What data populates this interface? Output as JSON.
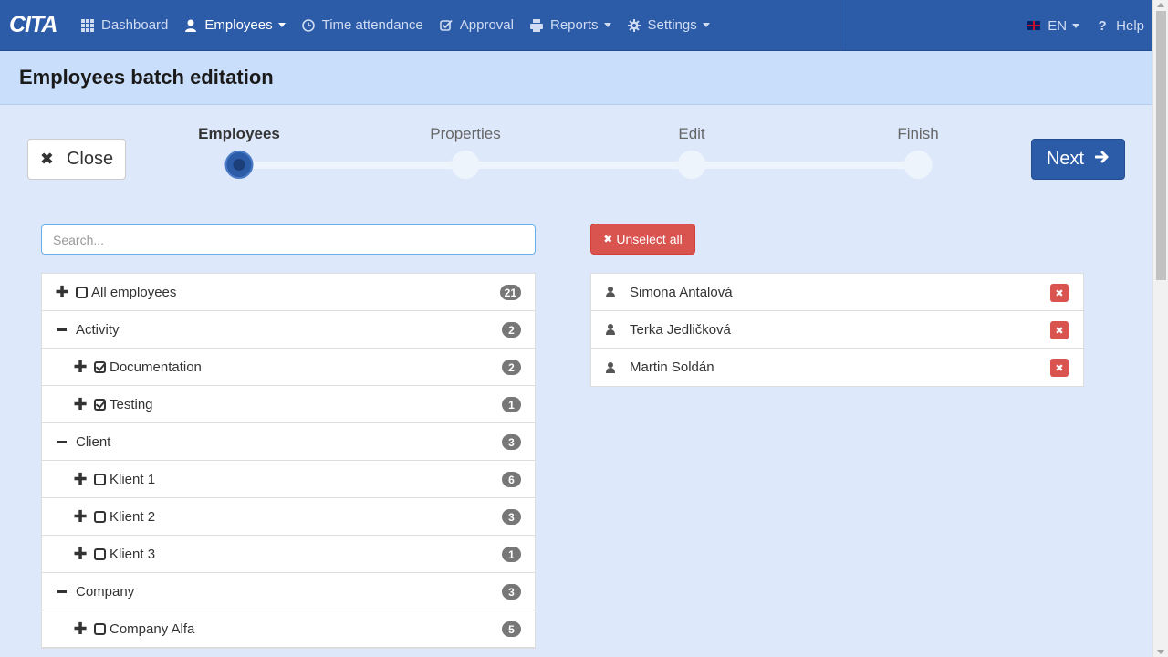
{
  "navbar": {
    "logo": "CITA",
    "items": [
      {
        "label": "Dashboard",
        "icon": "grid-icon",
        "caret": false,
        "active": false
      },
      {
        "label": "Employees",
        "icon": "user-icon",
        "caret": true,
        "active": true
      },
      {
        "label": "Time attendance",
        "icon": "clock-icon",
        "caret": false,
        "active": false
      },
      {
        "label": "Approval",
        "icon": "check-square-icon",
        "caret": false,
        "active": false
      },
      {
        "label": "Reports",
        "icon": "printer-icon",
        "caret": true,
        "active": false
      },
      {
        "label": "Settings",
        "icon": "gear-icon",
        "caret": true,
        "active": false
      }
    ],
    "language": "EN",
    "help": "Help"
  },
  "page": {
    "title": "Employees batch editation"
  },
  "buttons": {
    "close": "Close",
    "next": "Next",
    "unselect_all": "Unselect all"
  },
  "wizard": {
    "steps": [
      "Employees",
      "Properties",
      "Edit",
      "Finish"
    ],
    "active_index": 0
  },
  "search": {
    "placeholder": "Search..."
  },
  "tree": [
    {
      "label": "All employees",
      "count": "21",
      "level": 0,
      "toggle": "plus",
      "checkbox": "empty"
    },
    {
      "label": "Activity",
      "count": "2",
      "level": 0,
      "toggle": "minus",
      "checkbox": "none"
    },
    {
      "label": "Documentation",
      "count": "2",
      "level": 1,
      "toggle": "plus",
      "checkbox": "checked"
    },
    {
      "label": "Testing",
      "count": "1",
      "level": 1,
      "toggle": "plus",
      "checkbox": "checked"
    },
    {
      "label": "Client",
      "count": "3",
      "level": 0,
      "toggle": "minus",
      "checkbox": "none"
    },
    {
      "label": "Klient 1",
      "count": "6",
      "level": 1,
      "toggle": "plus",
      "checkbox": "empty"
    },
    {
      "label": "Klient 2",
      "count": "3",
      "level": 1,
      "toggle": "plus",
      "checkbox": "empty"
    },
    {
      "label": "Klient 3",
      "count": "1",
      "level": 1,
      "toggle": "plus",
      "checkbox": "empty"
    },
    {
      "label": "Company",
      "count": "3",
      "level": 0,
      "toggle": "minus",
      "checkbox": "none"
    },
    {
      "label": "Company Alfa",
      "count": "5",
      "level": 1,
      "toggle": "plus",
      "checkbox": "empty"
    }
  ],
  "selected_employees": [
    {
      "name": "Simona Antalová"
    },
    {
      "name": "Terka Jedličková"
    },
    {
      "name": "Martin Soldán"
    }
  ],
  "colors": {
    "navbar": "#2c5ba8",
    "header": "#c9defa",
    "background": "#dde9fb",
    "danger": "#d9534f",
    "badge": "#777777"
  }
}
